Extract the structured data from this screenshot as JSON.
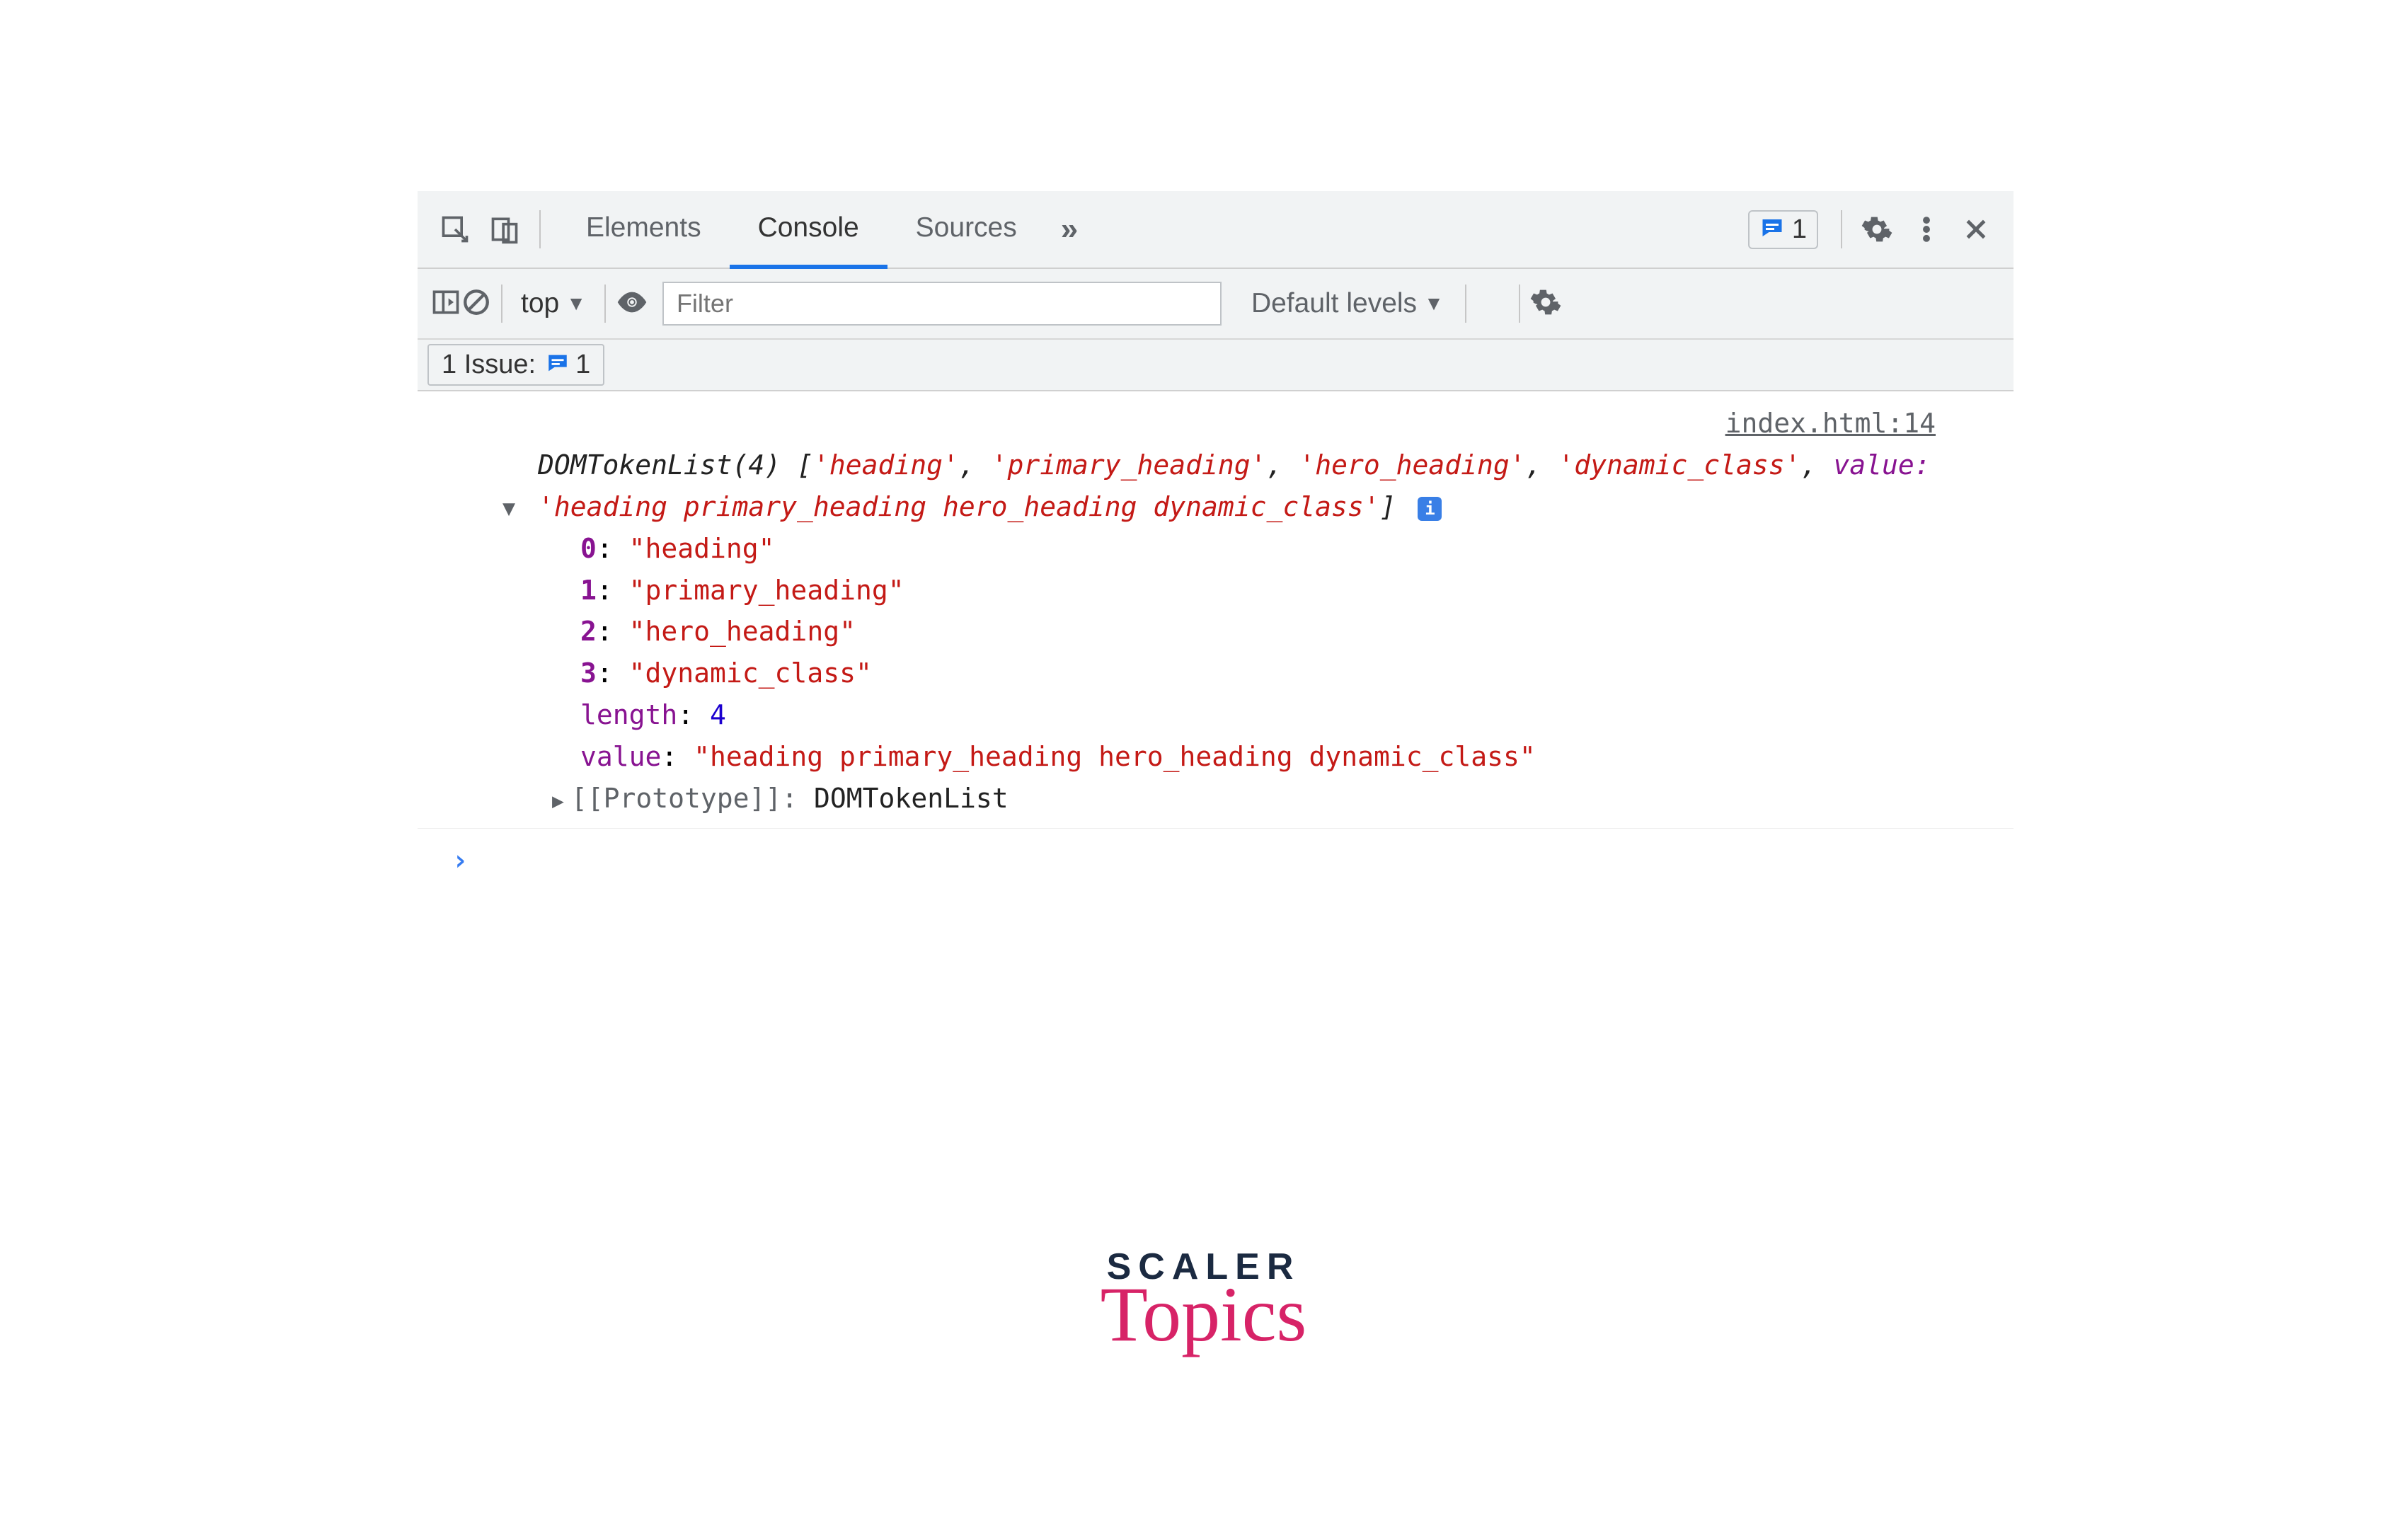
{
  "tabs": {
    "elements": "Elements",
    "console": "Console",
    "sources": "Sources"
  },
  "badge": {
    "count": "1"
  },
  "toolbar": {
    "context": "top",
    "filterPlaceholder": "Filter",
    "levels": "Default levels"
  },
  "issues": {
    "label": "1 Issue:",
    "count": "1"
  },
  "source": "index.html:14",
  "summary": {
    "prefix": "DOMTokenList(4) [",
    "items": [
      "'heading'",
      "'primary_heading'",
      "'hero_heading'",
      "'dynamic_class'"
    ],
    "sep": ", ",
    "valueKey": "value: ",
    "valueStr": "'heading primary_heading hero_heading dynamic_class'",
    "suffix": "]"
  },
  "props": {
    "entries": [
      {
        "k": "0",
        "v": "\"heading\""
      },
      {
        "k": "1",
        "v": "\"primary_heading\""
      },
      {
        "k": "2",
        "v": "\"hero_heading\""
      },
      {
        "k": "3",
        "v": "\"dynamic_class\""
      }
    ],
    "lengthKey": "length",
    "lengthVal": "4",
    "valueKey": "value",
    "valueVal": "\"heading primary_heading hero_heading dynamic_class\""
  },
  "proto": {
    "key": "[[Prototype]]",
    "val": "DOMTokenList"
  },
  "logo": {
    "top": "SCALER",
    "bottom": "Topics"
  }
}
